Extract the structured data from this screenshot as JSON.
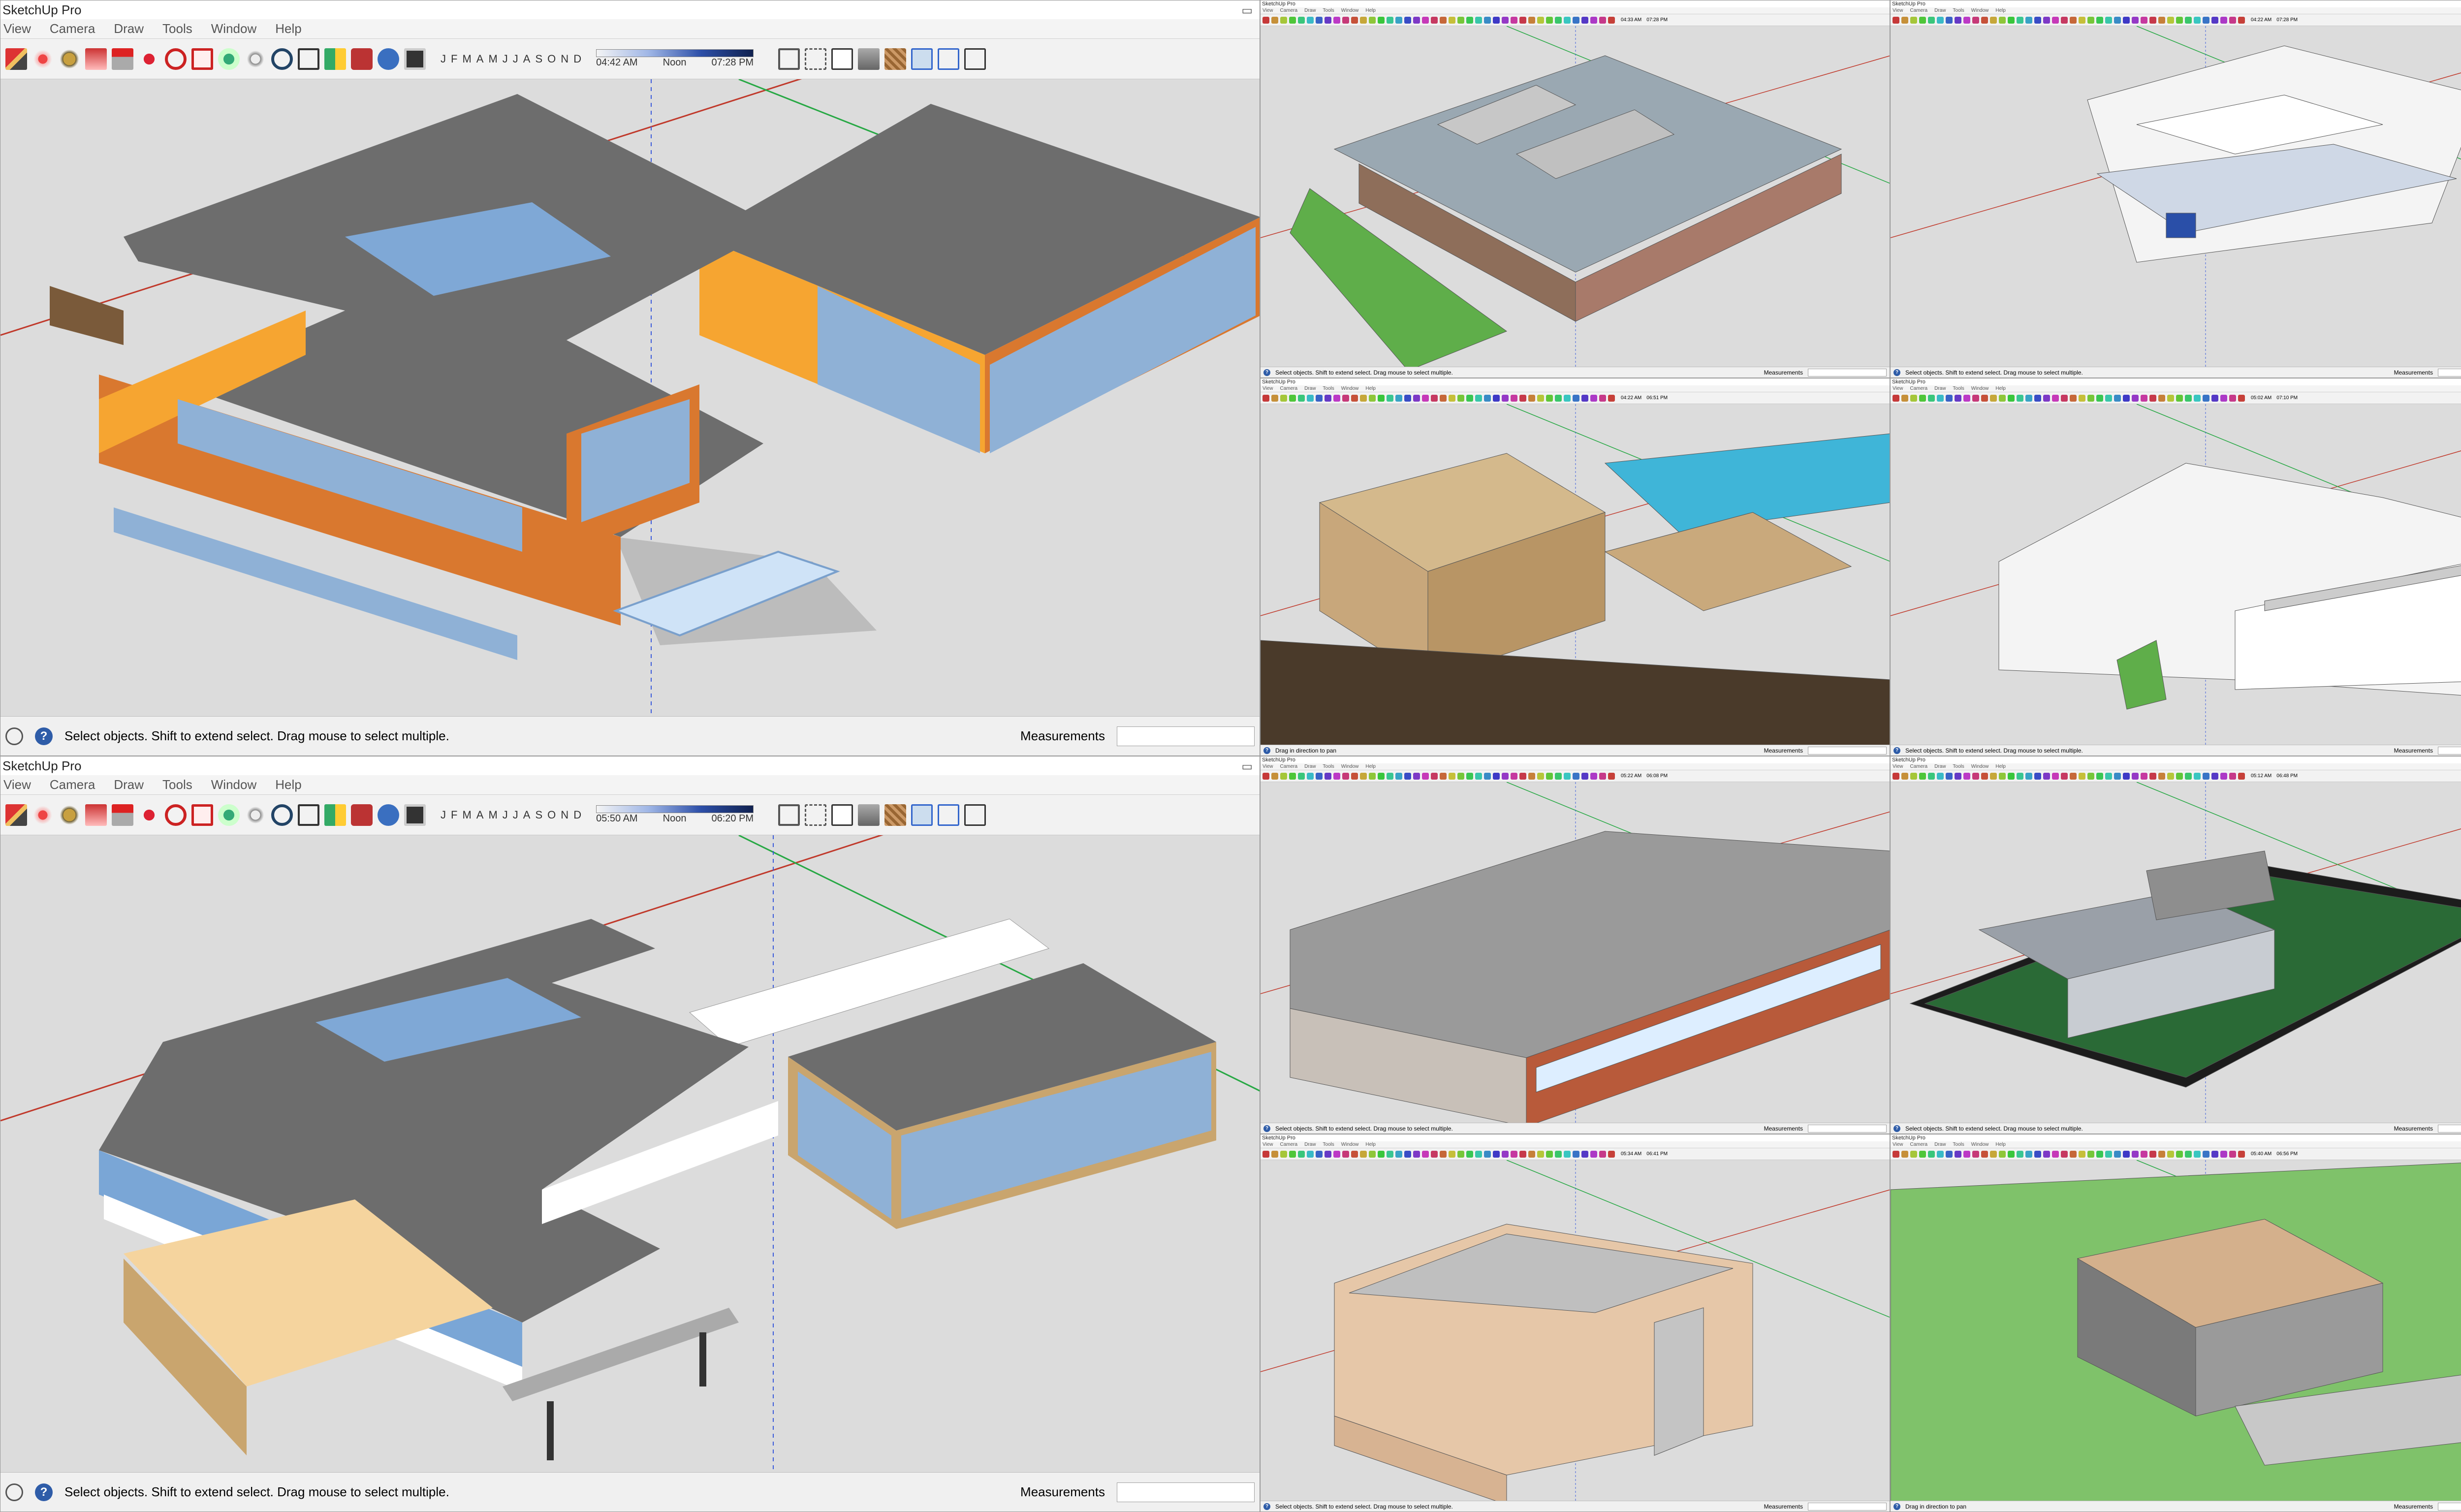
{
  "app_title": "SketchUp Pro",
  "menu": [
    "View",
    "Camera",
    "Draw",
    "Tools",
    "Window",
    "Help"
  ],
  "months": [
    "J",
    "F",
    "M",
    "A",
    "M",
    "J",
    "J",
    "A",
    "S",
    "O",
    "N",
    "D"
  ],
  "windows": [
    {
      "id": "main-top",
      "time_start": "04:42 AM",
      "noon": "Noon",
      "time_end": "07:28 PM",
      "status": "Select objects. Shift to extend select. Drag mouse to select multiple.",
      "measurements_label": "Measurements"
    },
    {
      "id": "main-bottom",
      "time_start": "05:50 AM",
      "noon": "Noon",
      "time_end": "06:20 PM",
      "status": "Select objects. Shift to extend select. Drag mouse to select multiple.",
      "measurements_label": "Measurements"
    },
    {
      "id": "thumb-1",
      "time_start": "04:33 AM",
      "time_end": "07:28 PM",
      "status": "Select objects. Shift to extend select. Drag mouse to select multiple.",
      "measurements_label": "Measurements"
    },
    {
      "id": "thumb-2",
      "time_start": "04:22 AM",
      "time_end": "07:28 PM",
      "status": "Select objects. Shift to extend select. Drag mouse to select multiple.",
      "measurements_label": "Measurements"
    },
    {
      "id": "thumb-3",
      "time_start": "04:22 AM",
      "time_end": "06:51 PM",
      "status": "Drag in direction to pan",
      "measurements_label": "Measurements"
    },
    {
      "id": "thumb-4",
      "time_start": "05:02 AM",
      "time_end": "07:10 PM",
      "status": "Select objects. Shift to extend select. Drag mouse to select multiple.",
      "measurements_label": "Measurements"
    },
    {
      "id": "thumb-5",
      "time_start": "05:22 AM",
      "time_end": "06:08 PM",
      "status": "Select objects. Shift to extend select. Drag mouse to select multiple.",
      "measurements_label": "Measurements"
    },
    {
      "id": "thumb-6",
      "time_start": "05:12 AM",
      "time_end": "06:48 PM",
      "status": "Select objects. Shift to extend select. Drag mouse to select multiple.",
      "measurements_label": "Measurements"
    },
    {
      "id": "thumb-7",
      "time_start": "05:34 AM",
      "time_end": "06:41 PM",
      "status": "Select objects. Shift to extend select. Drag mouse to select multiple.",
      "measurements_label": "Measurements"
    },
    {
      "id": "thumb-8",
      "time_start": "05:40 AM",
      "time_end": "06:56 PM",
      "status": "Drag in direction to pan",
      "measurements_label": "Measurements"
    }
  ],
  "icons": [
    "pencil-icon",
    "eraser-icon",
    "tape-measure-icon",
    "paint-bucket-icon",
    "push-pull-icon",
    "move-icon",
    "rotate-icon",
    "offset-icon",
    "orbit-icon",
    "pan-icon",
    "zoom-icon",
    "zoom-extents-icon",
    "section-plane-icon",
    "components-icon",
    "materials-icon",
    "shadow-toggle-icon",
    "fog-icon",
    "xray-icon",
    "wireframe-icon",
    "hidden-line-icon",
    "shaded-icon",
    "textured-icon",
    "monochrome-icon",
    "iso-view-icon",
    "top-view-icon",
    "front-view-icon",
    "right-view-icon",
    "back-view-icon",
    "left-view-icon"
  ],
  "colors": {
    "roof": "#6d6d6d",
    "orange_wall": "#d9782f",
    "bright_orange": "#f6a531",
    "tan_wall": "#c9a56e",
    "glass": "#8fb1d6",
    "sky_bg": "#dcdcdc",
    "axis_red": "#c0392b",
    "axis_green": "#27a844",
    "axis_blue": "#3b5bdb"
  }
}
